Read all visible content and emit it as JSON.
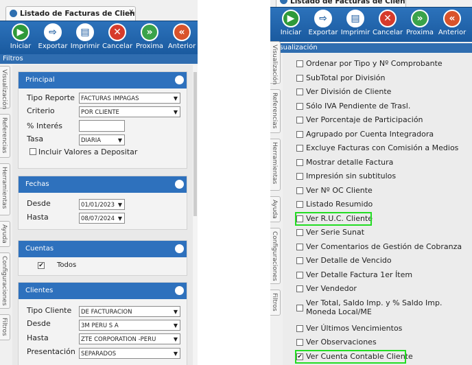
{
  "left": {
    "tab_title": "Listado de Facturas de Clientes I...",
    "tab_close": "x",
    "toolbar": [
      {
        "label": "Iniciar",
        "icon": "play-icon",
        "glyph": "▶",
        "color": "#2f9a3a"
      },
      {
        "label": "Exportar",
        "icon": "export-icon",
        "glyph": "⇨",
        "color": "#ffffff"
      },
      {
        "label": "Imprimir",
        "icon": "printer-icon",
        "glyph": "▤",
        "color": "#ffffff"
      },
      {
        "label": "Cancelar",
        "icon": "cancel-icon",
        "glyph": "✕",
        "color": "#d63b2b"
      },
      {
        "label": "Proxima",
        "icon": "next-icon",
        "glyph": "»",
        "color": "#3aa34a"
      },
      {
        "label": "Anterior",
        "icon": "previous-icon",
        "glyph": "«",
        "color": "#d9532b"
      }
    ],
    "section_label": "Filtros",
    "side_tabs": [
      "Visualización",
      "Referencias",
      "Herramientas",
      "Ayuda",
      "Configuraciones",
      "Filtros"
    ],
    "principal": {
      "title": "Principal",
      "tipo_reporte_label": "Tipo Reporte",
      "tipo_reporte_value": "FACTURAS IMPAGAS",
      "criterio_label": "Criterio",
      "criterio_value": "POR CLIENTE",
      "interes_label": "% Interés",
      "interes_value": "",
      "tasa_label": "Tasa",
      "tasa_value": "DIARIA",
      "incluir_label": "Incluir Valores a Depositar",
      "incluir_checked": false
    },
    "fechas": {
      "title": "Fechas",
      "desde_label": "Desde",
      "desde_value": "01/01/2023",
      "hasta_label": "Hasta",
      "hasta_value": "08/07/2024"
    },
    "cuentas": {
      "title": "Cuentas",
      "todos_label": "Todos",
      "todos_checked": true
    },
    "clientes": {
      "title": "Clientes",
      "tipo_label": "Tipo Cliente",
      "tipo_value": "DE FACTURACION",
      "desde_label": "Desde",
      "desde_value": "3M PERU S A",
      "hasta_label": "Hasta",
      "hasta_value": "ZTE CORPORATION -PERU",
      "presentacion_label": "Presentación",
      "presentacion_value": "SEPARADOS"
    }
  },
  "right": {
    "tab_title": "Listado de Facturas de Clientes I...",
    "section_label": "Visualización",
    "toolbar": [
      {
        "label": "Iniciar",
        "icon": "play-icon",
        "glyph": "▶",
        "color": "#2f9a3a"
      },
      {
        "label": "Exportar",
        "icon": "export-icon",
        "glyph": "⇨",
        "color": "#ffffff"
      },
      {
        "label": "Imprimir",
        "icon": "printer-icon",
        "glyph": "▤",
        "color": "#ffffff"
      },
      {
        "label": "Cancelar",
        "icon": "cancel-icon",
        "glyph": "✕",
        "color": "#d63b2b"
      },
      {
        "label": "Proxima",
        "icon": "next-icon",
        "glyph": "»",
        "color": "#3aa34a"
      },
      {
        "label": "Anterior",
        "icon": "previous-icon",
        "glyph": "«",
        "color": "#d9532b"
      }
    ],
    "side_tabs": [
      "Visualización",
      "Referencias",
      "Herramientas",
      "Ayuda",
      "Configuraciones",
      "Filtros"
    ],
    "options": [
      {
        "label": "Ordenar por Tipo y Nº Comprobante",
        "checked": false
      },
      {
        "label": "SubTotal por División",
        "checked": false
      },
      {
        "label": "Ver División de Cliente",
        "checked": false
      },
      {
        "label": "Sólo IVA Pendiente de Trasl.",
        "checked": false
      },
      {
        "label": "Ver Porcentaje de Participación",
        "checked": false
      },
      {
        "label": "Agrupado por Cuenta Integradora",
        "checked": false
      },
      {
        "label": "Excluye Facturas con Comisión a Medios",
        "checked": false
      },
      {
        "label": "Mostrar detalle Factura",
        "checked": false
      },
      {
        "label": "Impresión sin subtitulos",
        "checked": false
      },
      {
        "label": "Ver Nº OC Cliente",
        "checked": false
      },
      {
        "label": "Listado Resumido",
        "checked": false
      },
      {
        "label": "Ver R.U.C. Cliente",
        "checked": false,
        "highlighted": true
      },
      {
        "label": "Ver Serie Sunat",
        "checked": false
      },
      {
        "label": "Ver Comentarios de Gestión de Cobranza",
        "checked": false
      },
      {
        "label": "Ver Detalle de Vencido",
        "checked": false
      },
      {
        "label": "Ver Detalle Factura 1er Ítem",
        "checked": false
      },
      {
        "label": "Ver Vendedor",
        "checked": false
      },
      {
        "label": "Ver Total, Saldo Imp. y % Saldo Imp.",
        "label2": "Moneda Local/ME",
        "checked": false
      },
      {
        "label": "Ver Últimos Vencimientos",
        "checked": false
      },
      {
        "label": "Ver Observaciones",
        "checked": false
      },
      {
        "label": "Ver Cuenta Contable Cliente",
        "checked": true,
        "highlighted": true
      }
    ],
    "highlight_color": "#22dd22"
  }
}
